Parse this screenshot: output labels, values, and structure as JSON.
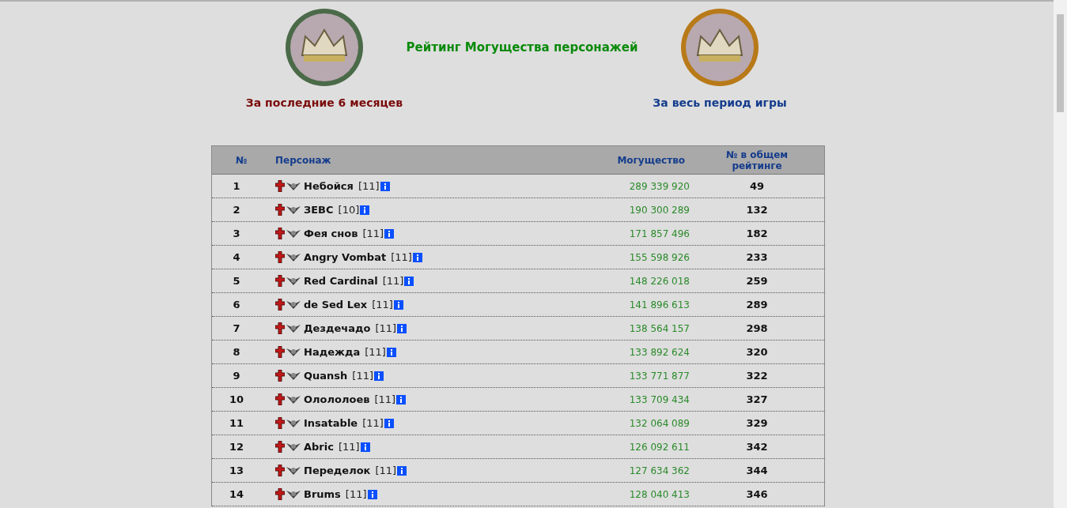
{
  "title": "Рейтинг Могущества персонажей",
  "periods": [
    {
      "label": "За последние 6 месяцев",
      "selected": true
    },
    {
      "label": "За весь период игры",
      "selected": false
    }
  ],
  "table": {
    "columns": [
      "№",
      "Персонаж",
      "Могущество",
      "№ в общем рейтинге"
    ],
    "rows": [
      {
        "place": "1",
        "name": "Небойся",
        "level": "[11]",
        "power": "289 339 920",
        "overall": "49"
      },
      {
        "place": "2",
        "name": "ЗЕВС",
        "level": "[10]",
        "power": "190 300 289",
        "overall": "132"
      },
      {
        "place": "3",
        "name": "Фея снов",
        "level": "[11]",
        "power": "171 857 496",
        "overall": "182"
      },
      {
        "place": "4",
        "name": "Angry Vombat",
        "level": "[11]",
        "power": "155 598 926",
        "overall": "233"
      },
      {
        "place": "5",
        "name": "Red Cardinal",
        "level": "[11]",
        "power": "148 226 018",
        "overall": "259"
      },
      {
        "place": "6",
        "name": "de Sed Lex",
        "level": "[11]",
        "power": "141 896 613",
        "overall": "289"
      },
      {
        "place": "7",
        "name": "Дездечадо",
        "level": "[11]",
        "power": "138 564 157",
        "overall": "298"
      },
      {
        "place": "8",
        "name": "Надежда",
        "level": "[11]",
        "power": "133 892 624",
        "overall": "320"
      },
      {
        "place": "9",
        "name": "Quansh",
        "level": "[11]",
        "power": "133 771 877",
        "overall": "322"
      },
      {
        "place": "10",
        "name": "Олололоев",
        "level": "[11]",
        "power": "133 709 434",
        "overall": "327"
      },
      {
        "place": "11",
        "name": "Insatable",
        "level": "[11]",
        "power": "132 064 089",
        "overall": "329"
      },
      {
        "place": "12",
        "name": "Abric",
        "level": "[11]",
        "power": "126 092 611",
        "overall": "342"
      },
      {
        "place": "13",
        "name": "Переделок",
        "level": "[11]",
        "power": "127 634 362",
        "overall": "344"
      },
      {
        "place": "14",
        "name": "Brums",
        "level": "[11]",
        "power": "128 040 413",
        "overall": "346"
      }
    ]
  }
}
